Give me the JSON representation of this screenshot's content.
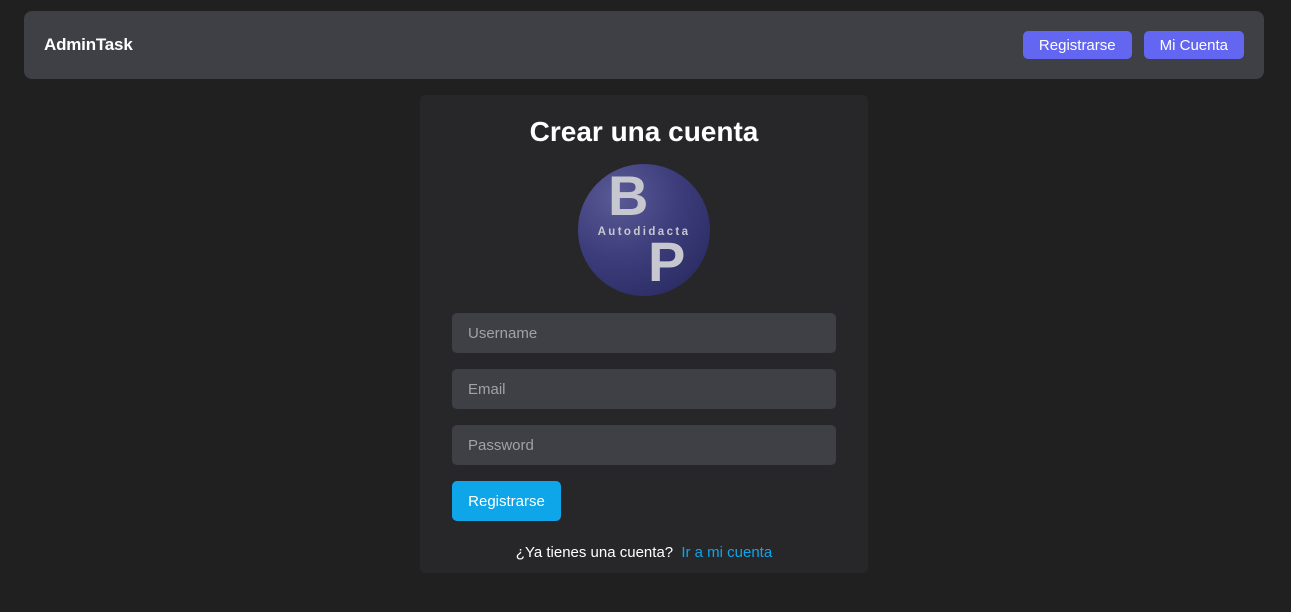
{
  "navbar": {
    "brand": "AdminTask",
    "buttons": [
      {
        "label": "Registrarse"
      },
      {
        "label": "Mi Cuenta"
      }
    ]
  },
  "form": {
    "title": "Crear una cuenta",
    "logo": {
      "letter_top": "B",
      "letter_bottom": "P",
      "caption": "Autodidacta"
    },
    "fields": {
      "username": {
        "placeholder": "Username",
        "value": ""
      },
      "email": {
        "placeholder": "Email",
        "value": ""
      },
      "password": {
        "placeholder": "Password",
        "value": ""
      }
    },
    "submit_label": "Registrarse",
    "footer_text": "¿Ya tienes una cuenta?",
    "footer_link": "Ir a mi cuenta"
  },
  "colors": {
    "background": "#202020",
    "navbar": "#3f3f46",
    "card": "#27272a",
    "nav_button": "#6366f1",
    "submit_button": "#0ea5e9",
    "link": "#0ea5e9"
  }
}
